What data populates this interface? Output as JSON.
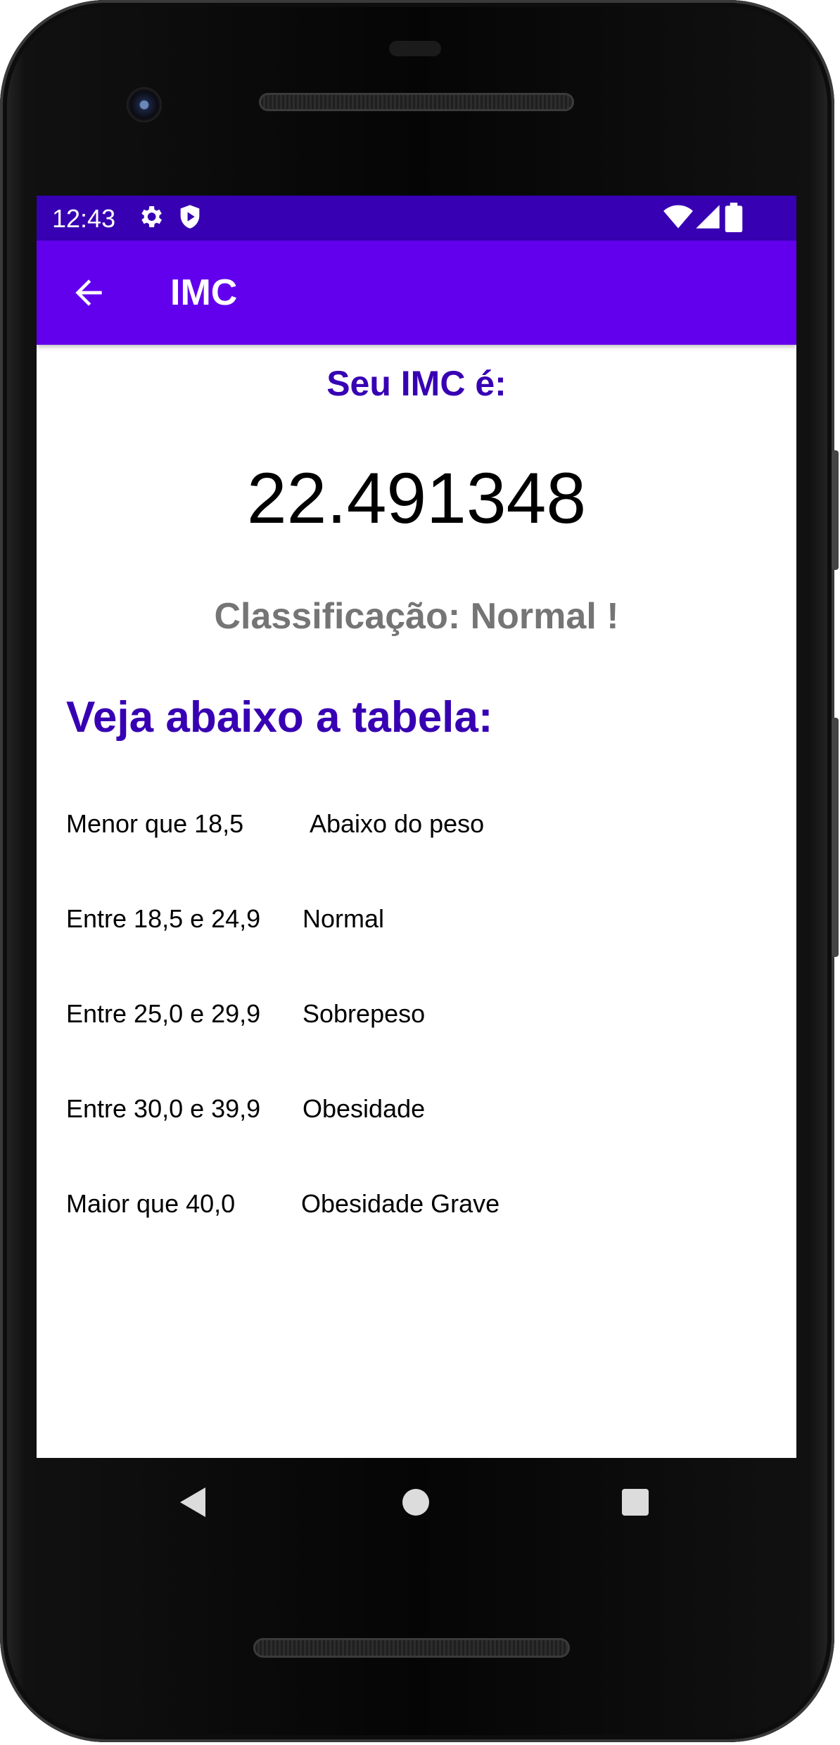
{
  "status_bar": {
    "time": "12:43",
    "left_icons": [
      "settings-icon",
      "shield-play-icon"
    ],
    "right_icons": [
      "wifi-icon",
      "signal-icon",
      "battery-icon"
    ]
  },
  "app_bar": {
    "title": "IMC",
    "back_icon": "arrow-back-icon",
    "color": "#6200ee",
    "status_color": "#3700b3"
  },
  "result": {
    "heading": "Seu IMC é:",
    "value": "22.491348",
    "classification": "Classificação: Normal !"
  },
  "table": {
    "title": "Veja abaixo a tabela:",
    "rows": [
      {
        "range": "Menor que 18,5",
        "label": "Abaixo do peso"
      },
      {
        "range": "Entre 18,5 e 24,9",
        "label": "Normal"
      },
      {
        "range": "Entre 25,0 e 29,9",
        "label": "Sobrepeso"
      },
      {
        "range": "Entre 30,0 e 39,9",
        "label": "Obesidade"
      },
      {
        "range": "Maior que 40,0",
        "label": "Obesidade Grave"
      }
    ]
  },
  "nav_bar": {
    "buttons": [
      "back-triangle-icon",
      "home-circle-icon",
      "recents-square-icon"
    ]
  },
  "colors": {
    "accent": "#3700b3",
    "secondary_text": "#757575"
  }
}
